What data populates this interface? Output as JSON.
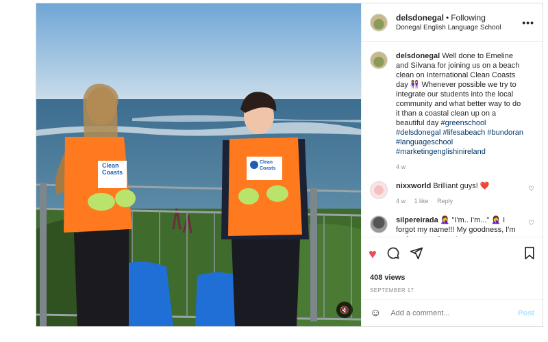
{
  "post": {
    "username": "delsdonegal",
    "dot": "•",
    "following": "Following",
    "location": "Donegal English Language School"
  },
  "caption": {
    "username": "delsdonegal",
    "text": "Well done to Emeline and Silvana for joining us on a beach clean on International Clean Coasts day 👩🏽‍🤝‍👩🏻 Whenever possible we try to integrate our students into the local community and what better way to do it than a coastal clean up on a beautiful day",
    "tags": [
      "#greenschool",
      "#delsdonegal",
      "#lifesabeach",
      "#bundoran",
      "#languageschool",
      "#marketingenglishinireland"
    ],
    "time": "4 w"
  },
  "comments": [
    {
      "username": "nixxworld",
      "text": "Brilliant guys! ❤️",
      "time": "4 w",
      "likes": "1 like",
      "reply": "Reply"
    },
    {
      "username": "silpereirada",
      "text": "🤦‍♀️ \"I'm.. I'm...\" 🤦‍♀️ I forgot my name!!! My goodness, I'm embarrassed now!",
      "time": "",
      "likes": "",
      "reply": ""
    }
  ],
  "stats": {
    "views": "408 views",
    "date": "SEPTEMBER 17"
  },
  "add_comment": {
    "placeholder": "Add a comment...",
    "post_label": "Post"
  },
  "vest": {
    "line1": "Clean",
    "line2": "Coasts"
  },
  "colors": {
    "like": "#ed4956",
    "vest": "#ff7a1f",
    "link": "#00376b",
    "post": "#b2dffc"
  },
  "icons": [
    "more-icon",
    "heart-icon",
    "comment-icon",
    "share-icon",
    "bookmark-icon",
    "emoji-icon",
    "mute-icon"
  ]
}
